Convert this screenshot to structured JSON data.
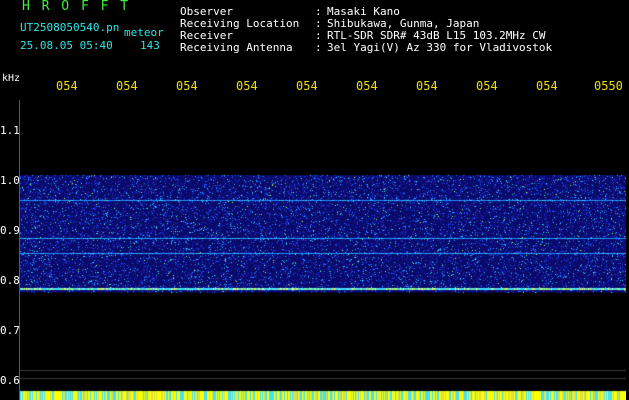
{
  "header": {
    "title": "H R O F F T",
    "filename": "UT2508050540.pn",
    "type": "meteor",
    "datetime": "25.08.05 05:40",
    "count": "143"
  },
  "info": [
    {
      "label": "Observer",
      "value": "Masaki Kano"
    },
    {
      "label": "Receiving Location",
      "value": "Shibukawa, Gunma, Japan"
    },
    {
      "label": "Receiver",
      "value": "RTL-SDR SDR# 43dB L15 103.2MHz CW"
    },
    {
      "label": "Receiving Antenna",
      "value": "3el Yagi(V) Az 330 for Vladivostok"
    }
  ],
  "info_colon": ":",
  "axis": {
    "y_unit": "kHz",
    "y_ticks": [
      "1.1",
      "1.0",
      "0.9",
      "0.8",
      "0.7",
      "0.6"
    ],
    "x_ticks": [
      "054",
      "054",
      "054",
      "054",
      "054",
      "054",
      "054",
      "054",
      "054",
      "0550"
    ]
  },
  "colors": {
    "green": "#3ff03f",
    "cyan": "#2ee6e6",
    "yellow": "#f0e000",
    "background": "#000000"
  },
  "chart_data": {
    "type": "heatmap",
    "x_ticks": [
      "054",
      "054",
      "054",
      "054",
      "054",
      "054",
      "054",
      "054",
      "054",
      "0550"
    ],
    "y_ticks": [
      "1.1",
      "1.0",
      "0.9",
      "0.8",
      "0.7",
      "0.6"
    ],
    "y_unit": "kHz",
    "noise_band_khz": [
      0.775,
      1.01
    ],
    "carrier_lines_khz": [
      0.785,
      0.855,
      0.885,
      0.96
    ]
  }
}
